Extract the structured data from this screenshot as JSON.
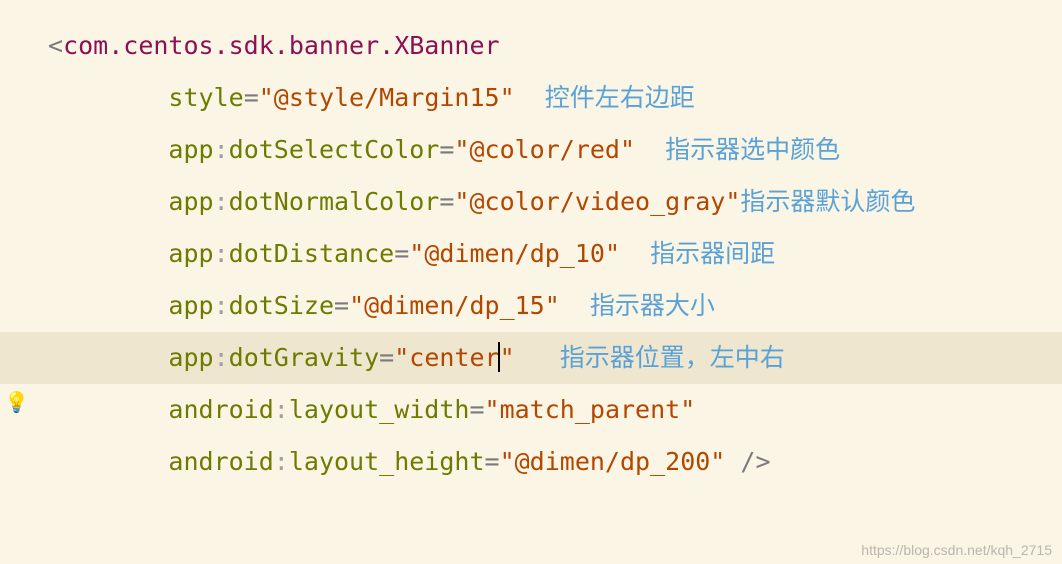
{
  "tag_open": "<",
  "tag_name": "com.centos.sdk.banner.XBanner",
  "lines": [
    {
      "ns": "",
      "attr": "style",
      "eq": "=",
      "val": "\"@style/Margin15\"",
      "comment": "控件左右边距",
      "comment_pad": "  "
    },
    {
      "ns": "app",
      "attr": "dotSelectColor",
      "eq": "=",
      "val": "\"@color/red\"",
      "comment": "指示器选中颜色",
      "comment_pad": "  "
    },
    {
      "ns": "app",
      "attr": "dotNormalColor",
      "eq": "=",
      "val": "\"@color/video_gray\"",
      "comment": "指示器默认颜色",
      "comment_pad": ""
    },
    {
      "ns": "app",
      "attr": "dotDistance",
      "eq": "=",
      "val": "\"@dimen/dp_10\"",
      "comment": "指示器间距",
      "comment_pad": "  "
    },
    {
      "ns": "app",
      "attr": "dotSize",
      "eq": "=",
      "val": "\"@dimen/dp_15\"",
      "comment": "指示器大小",
      "comment_pad": "  "
    },
    {
      "ns": "app",
      "attr": "dotGravity",
      "eq": "=",
      "val_pre": "\"center",
      "val_post": "\"",
      "comment": "指示器位置，左中右",
      "comment_pad": "   "
    },
    {
      "ns": "android",
      "attr": "layout_width",
      "eq": "=",
      "val": "\"match_parent\"",
      "comment": "",
      "comment_pad": ""
    },
    {
      "ns": "android",
      "attr": "layout_height",
      "eq": "=",
      "val": "\"@dimen/dp_200\"",
      "comment": "",
      "comment_pad": " ",
      "close": "/>"
    }
  ],
  "indent": "        ",
  "watermark": "https://blog.csdn.net/kqh_2715"
}
